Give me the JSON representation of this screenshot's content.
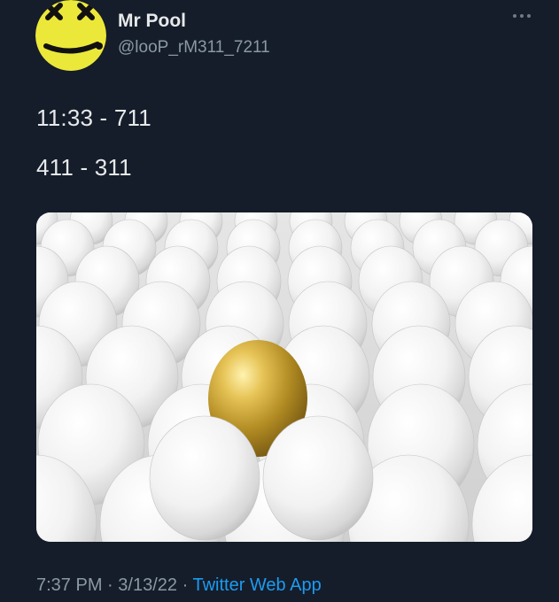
{
  "author": {
    "display_name": "Mr Pool",
    "handle": "@looP_rM311_7211",
    "avatar_icon": "yellow-smiley-x-eyes-icon"
  },
  "menu": {
    "more_icon": "ellipsis-icon"
  },
  "tweet": {
    "lines": [
      "11:33 - 711",
      "411 - 311"
    ]
  },
  "media": {
    "description_icon": "golden-egg-among-white-eggs-image"
  },
  "meta": {
    "time": "7:37 PM",
    "separator": "·",
    "date": "3/13/22",
    "source": "Twitter Web App"
  },
  "colors": {
    "background": "#151d2a",
    "text": "#e7e9ea",
    "muted": "#8b98a5",
    "link": "#1d9bf0",
    "avatar_yellow": "#ece83a",
    "egg_gold": "#c9a22c"
  }
}
